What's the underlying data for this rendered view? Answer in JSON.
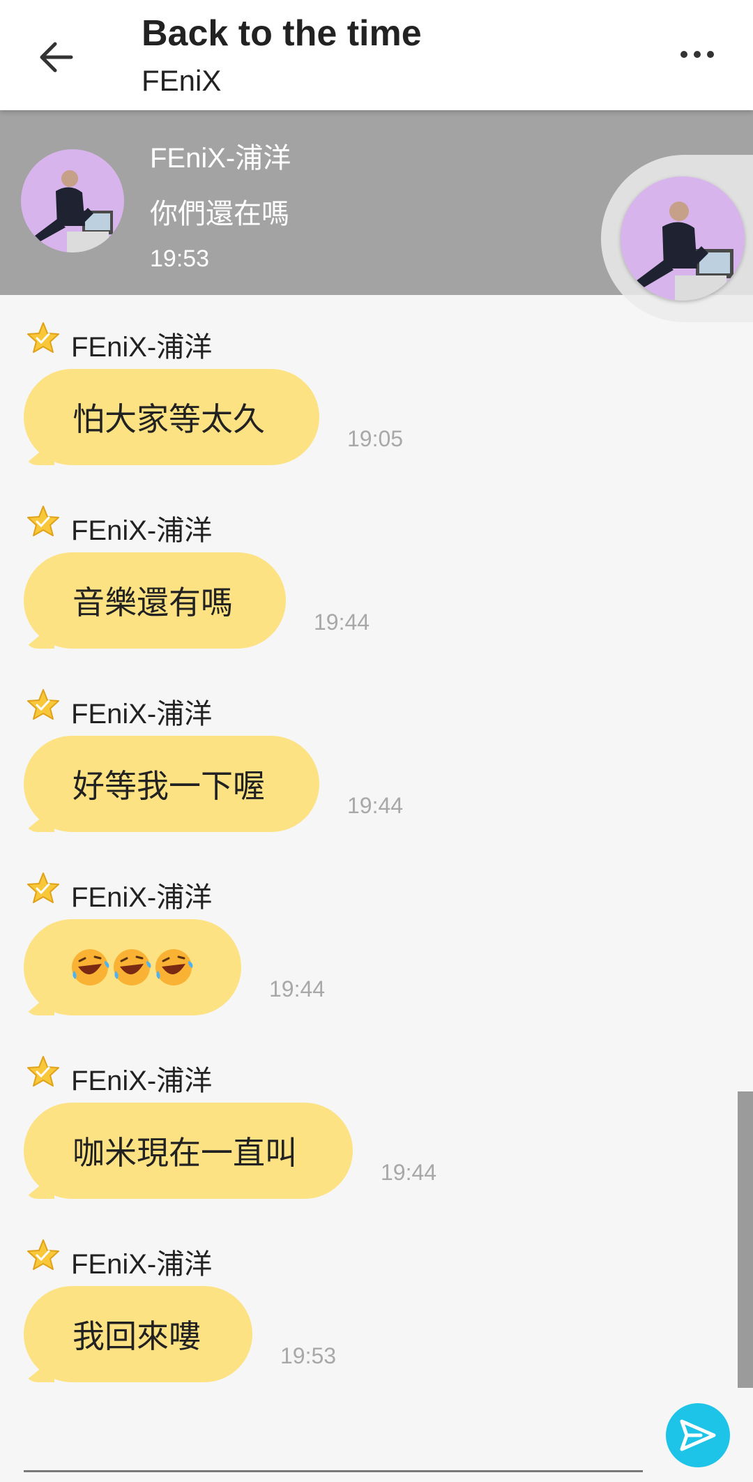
{
  "header": {
    "title": "Back to the time",
    "subtitle": "FEniX",
    "back_icon": "arrow-left-icon",
    "more_icon": "more-horizontal-icon"
  },
  "pinned": {
    "name": "FEniX-浦洋",
    "message": "你們還在嗎",
    "time": "19:53"
  },
  "messages": [
    {
      "sender": "FEniX-浦洋",
      "text": "怕大家等太久",
      "time": "19:05"
    },
    {
      "sender": "FEniX-浦洋",
      "text": "音樂還有嗎",
      "time": "19:44"
    },
    {
      "sender": "FEniX-浦洋",
      "text": "好等我一下喔",
      "time": "19:44"
    },
    {
      "sender": "FEniX-浦洋",
      "text": "",
      "emoji": "rolling-on-floor-laughing x3",
      "time": "19:44"
    },
    {
      "sender": "FEniX-浦洋",
      "text": "咖米現在一直叫",
      "time": "19:44"
    },
    {
      "sender": "FEniX-浦洋",
      "text": "我回來嘍",
      "time": "19:53"
    }
  ],
  "composer": {
    "send_icon": "send-icon"
  },
  "colors": {
    "bubble": "#fde283",
    "pinned_bg": "#a3a3a3",
    "send_button": "#1ec3e8",
    "avatar_bg": "#d8b4ec"
  }
}
